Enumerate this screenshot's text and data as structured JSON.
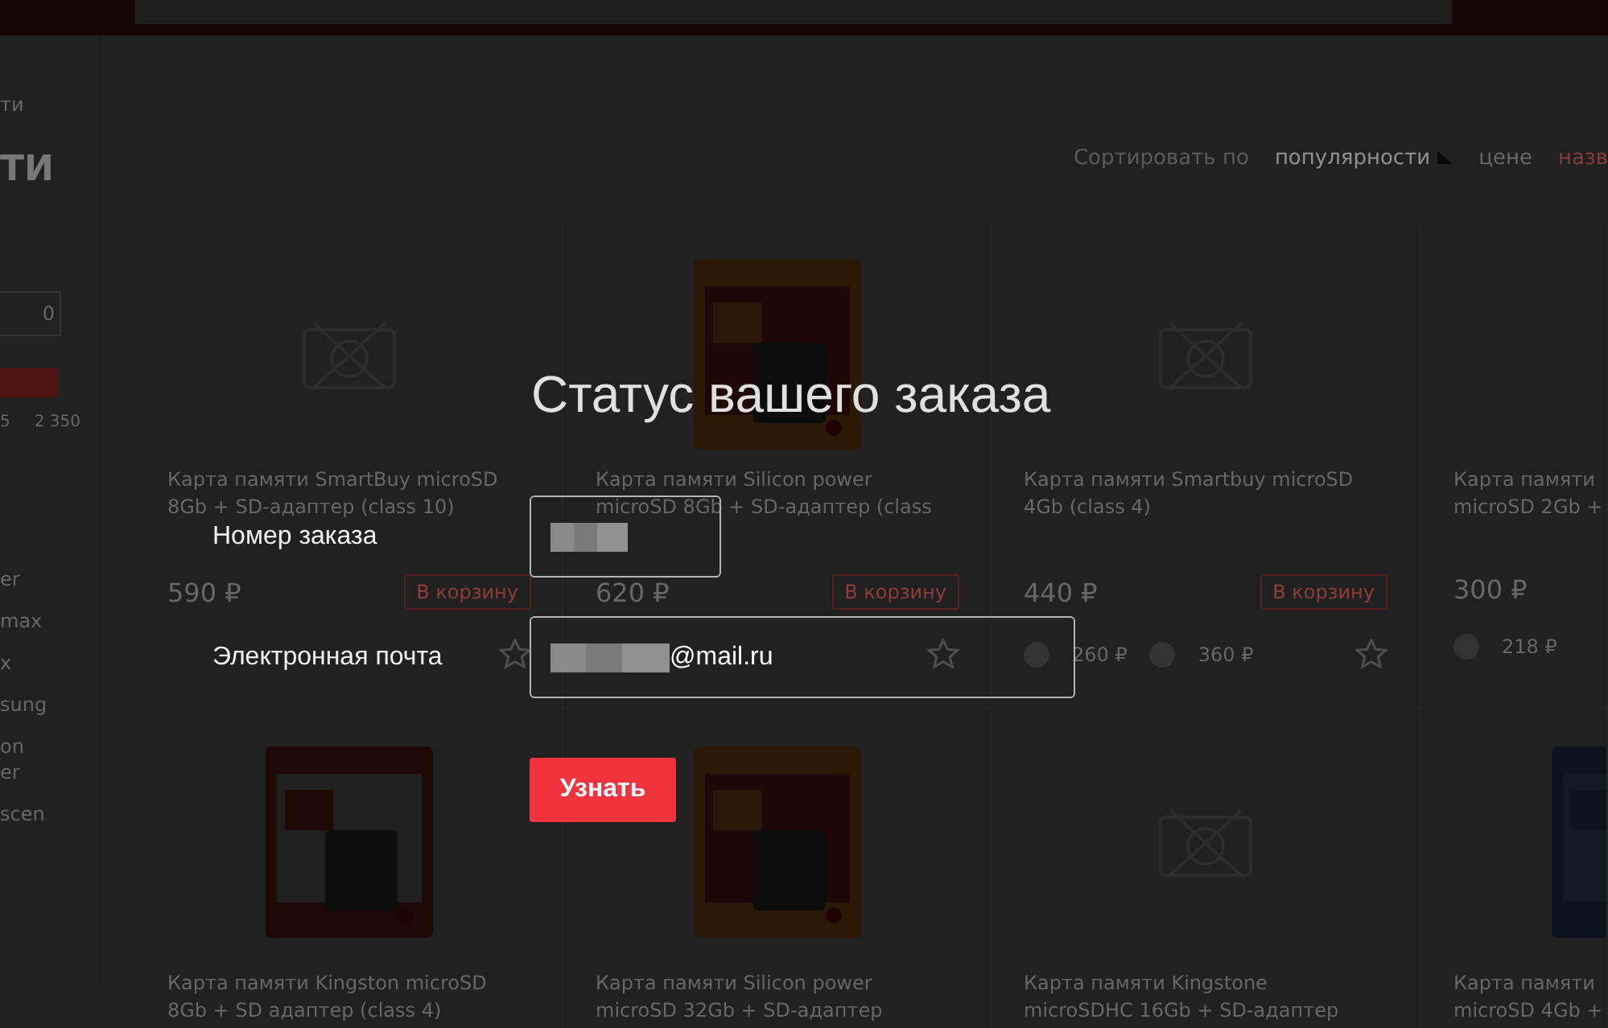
{
  "sidebar": {
    "breadcrumb": "ти",
    "title": "ТИ",
    "price_from": "0",
    "price_slider": {
      "level": 1
    },
    "range_min": "5",
    "range_max": "2 350",
    "brands": [
      "er",
      "max",
      "x",
      "sung",
      "on\ner",
      "scen"
    ]
  },
  "sort": {
    "label": "Сортировать по",
    "options": [
      {
        "label": "популярности",
        "selected": true
      },
      {
        "label": "цене",
        "selected": false
      },
      {
        "label": "назв",
        "selected": false
      }
    ]
  },
  "products": [
    {
      "image": {
        "kind": "no_image"
      },
      "title_lines": [
        "Карта памяти SmartBuy microSD",
        "8Gb + SD-адаптер (class 10)"
      ],
      "price": "590 ₽",
      "cart_button": "В корзину"
    },
    {
      "image": {
        "kind": "picture"
      },
      "title_lines": [
        "Карта памяти Silicon power",
        "microSD 8Gb + SD-адаптер (class"
      ],
      "price": "620 ₽",
      "cart_button": "В корзину"
    },
    {
      "image": {
        "kind": "no_image"
      },
      "title_lines": [
        "Карта памяти Smartbuy microSD",
        "4Gb (class 4)"
      ],
      "price": "440 ₽",
      "cart_button": "В корзину",
      "bonus_prices": [
        "260 ₽",
        "360 ₽"
      ]
    },
    {
      "title_lines": [
        "Карта памяти",
        "microSD 2Gb +"
      ],
      "price": "300 ₽",
      "bonus_prices": [
        "218 ₽"
      ]
    },
    {
      "image": {
        "kind": "picture"
      },
      "title_lines": [
        "Карта памяти Kingston microSD",
        "8Gb + SD адаптер (class 4)"
      ]
    },
    {
      "image": {
        "kind": "picture"
      },
      "title_lines": [
        "Карта памяти Silicon power",
        "microSD 32Gb + SD-адаптер"
      ]
    },
    {
      "image": {
        "kind": "no_image"
      },
      "title_lines": [
        "Карта памяти Kingstone",
        "microSDHC 16Gb + SD-адаптер"
      ]
    },
    {
      "image": {
        "kind": "picture"
      },
      "title_lines": [
        "Карта памяти",
        "microSD 4Gb +"
      ]
    }
  ],
  "modal": {
    "title": "Статус вашего заказа",
    "fields": [
      {
        "label": "Номер заказа",
        "redacted": true
      },
      {
        "label": "Электронная почта",
        "redacted": true,
        "value": "@mail.ru"
      }
    ],
    "button": "Узнать"
  }
}
